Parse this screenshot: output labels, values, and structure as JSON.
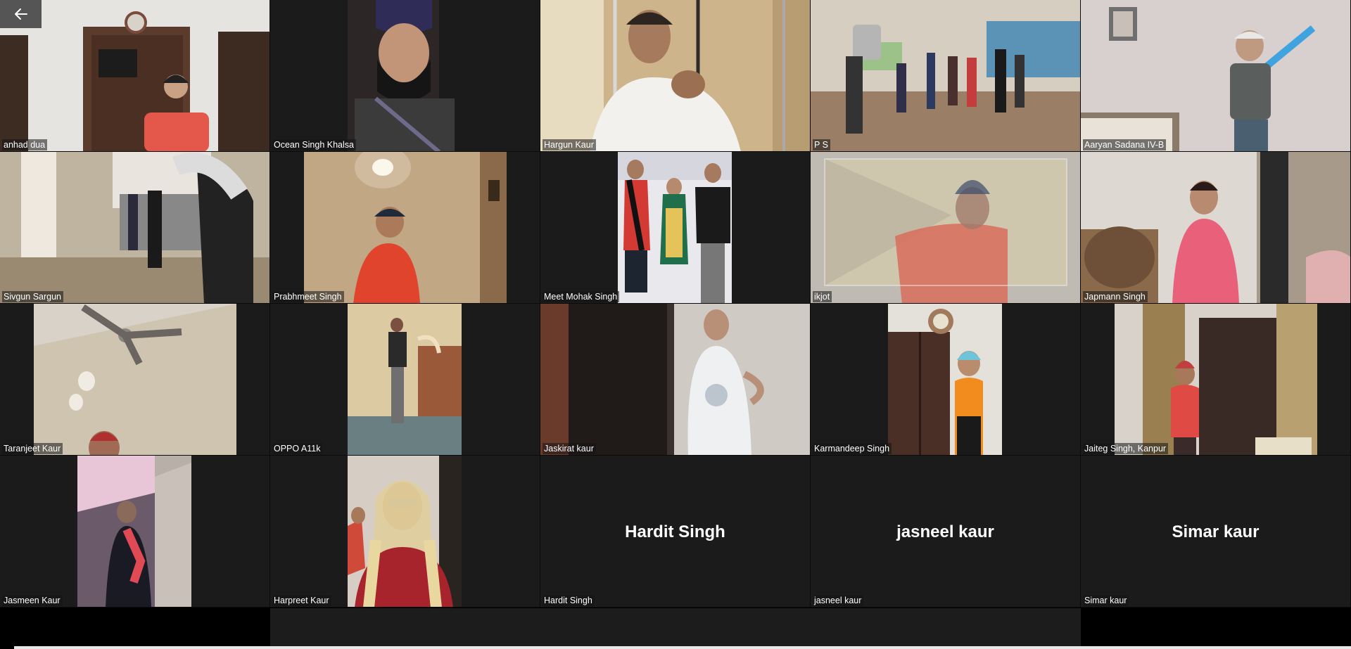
{
  "participants": [
    {
      "name": "anhad dua",
      "video": true
    },
    {
      "name": "Ocean Singh Khalsa",
      "video": true
    },
    {
      "name": "Hargun Kaur",
      "video": true
    },
    {
      "name": "P S",
      "video": true
    },
    {
      "name": "Aaryan Sadana IV-B",
      "video": true
    },
    {
      "name": "Sivgun Sargun",
      "video": true
    },
    {
      "name": "Prabhmeet Singh",
      "video": true
    },
    {
      "name": "Meet Mohak Singh",
      "video": true
    },
    {
      "name": "ikjot",
      "video": true
    },
    {
      "name": "Japmann Singh",
      "video": true
    },
    {
      "name": "Taranjeet Kaur",
      "video": true
    },
    {
      "name": "OPPO A11k",
      "video": true
    },
    {
      "name": "Jaskirat kaur",
      "video": true
    },
    {
      "name": "Karmandeep Singh",
      "video": true
    },
    {
      "name": "Jaiteg Singh, Kanpur",
      "video": true
    },
    {
      "name": "Jasmeen Kaur",
      "video": true
    },
    {
      "name": "Harpreet Kaur",
      "video": true
    },
    {
      "name": "Hardit Singh",
      "video": false,
      "display_name": "Hardit Singh"
    },
    {
      "name": "jasneel kaur",
      "video": false,
      "display_name": "jasneel kaur"
    },
    {
      "name": "Simar kaur",
      "video": false,
      "display_name": "Simar kaur"
    }
  ],
  "colors": {
    "tile_background": "#1b1b1b",
    "page_background": "#000000",
    "text": "#ffffff"
  },
  "icons": {
    "back": "arrow-left-icon"
  }
}
